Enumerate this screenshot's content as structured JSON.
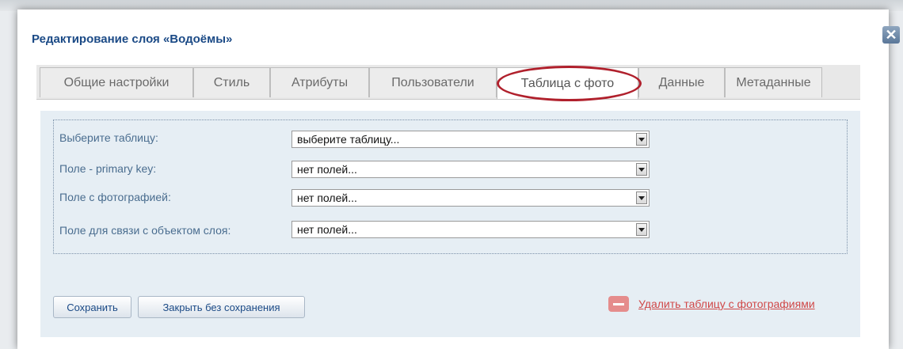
{
  "dialog": {
    "title": "Редактирование слоя «Водоёмы»",
    "close_glyph": "✕"
  },
  "tabs": [
    {
      "label": "Общие настройки",
      "active": false
    },
    {
      "label": "Стиль",
      "active": false
    },
    {
      "label": "Атрибуты",
      "active": false
    },
    {
      "label": "Пользователи",
      "active": false
    },
    {
      "label": "Таблица с фото",
      "active": true
    },
    {
      "label": "Данные",
      "active": false
    },
    {
      "label": "Метаданные",
      "active": false
    }
  ],
  "form": {
    "fields": [
      {
        "label": "Выберите таблицу:",
        "value": "выберите таблицу..."
      },
      {
        "label": "Поле - primary key:",
        "value": "нет полей..."
      },
      {
        "label": "Поле с фотографией:",
        "value": "нет полей..."
      },
      {
        "label": "Поле для связи с объектом слоя:",
        "value": "нет полей..."
      }
    ]
  },
  "actions": {
    "save": "Сохранить",
    "close_without_save": "Закрыть без сохранения",
    "delete_table": "Удалить таблицу с фотографиями"
  },
  "colors": {
    "title": "#1b4a86",
    "highlight_oval": "#b0202c",
    "delete_link": "#d04848"
  },
  "icons": {
    "close": "close-icon",
    "delete": "minus-icon",
    "dropdown": "chevron-down-icon"
  }
}
